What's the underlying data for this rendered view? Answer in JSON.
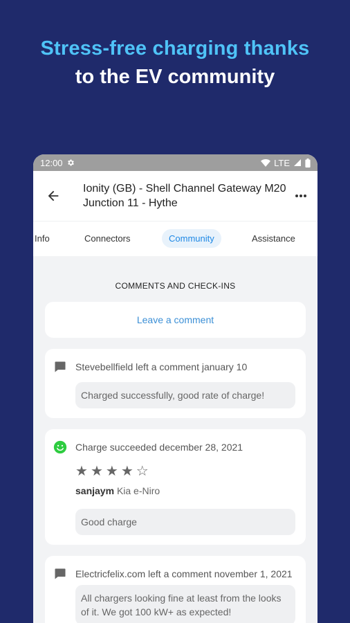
{
  "hero": {
    "line1": "Stress-free charging thanks",
    "line2": "to the EV community"
  },
  "status": {
    "time": "12:00",
    "network": "LTE"
  },
  "appbar": {
    "title": "Ionity (GB) -  Shell Channel Gateway M20 Junction 11 - Hythe"
  },
  "tabs": [
    {
      "label": "Info"
    },
    {
      "label": "Connectors"
    },
    {
      "label": "Community"
    },
    {
      "label": "Assistance"
    }
  ],
  "section": {
    "title": "COMMENTS AND CHECK-INS",
    "leave_comment": "Leave a comment"
  },
  "comments": [
    {
      "header": "Stevebellfield left a comment january 10",
      "text": "Charged successfully, good rate of charge!"
    },
    {
      "header": "Charge succeeded december 28, 2021",
      "rating": 4,
      "rating_max": 5,
      "user": "sanjaym",
      "vehicle": "Kia e-Niro",
      "text": "Good charge"
    },
    {
      "header": "Electricfelix.com left a comment november 1, 2021",
      "text": "All chargers looking fine at least from the looks of it. We got 100 kW+ as expected!"
    }
  ],
  "colors": {
    "background": "#1f2a6b",
    "hero_accent": "#4fc3f7",
    "active_tab": "#1e88e5",
    "success": "#2ecc40"
  }
}
